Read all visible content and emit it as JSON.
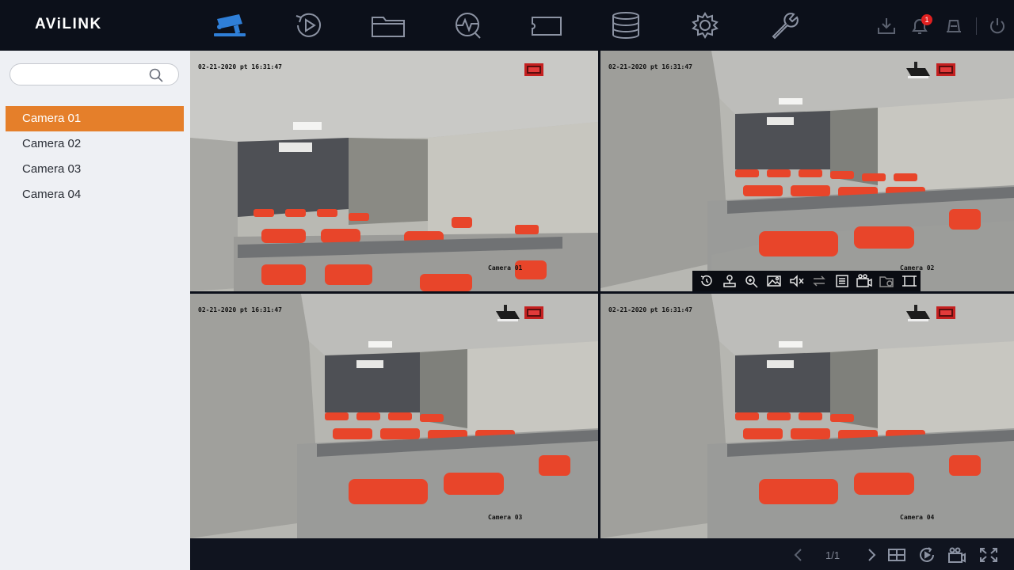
{
  "app": {
    "logo": "AViLINK"
  },
  "topnav": {
    "icons": [
      "live-view-camera-icon",
      "playback-icon",
      "file-folder-icon",
      "smart-analytics-icon",
      "tag-icon",
      "storage-database-icon",
      "settings-gear-icon",
      "maintenance-wrench-icon"
    ],
    "active_color": "#2f7fd8",
    "inactive_color": "#8c93a3"
  },
  "status": {
    "alarm_count": "1",
    "alarm_color": "#e02020"
  },
  "sidebar": {
    "search_placeholder": "",
    "cameras": [
      {
        "label": "Camera 01",
        "active": true
      },
      {
        "label": "Camera 02",
        "active": false
      },
      {
        "label": "Camera 03",
        "active": false
      },
      {
        "label": "Camera 04",
        "active": false
      }
    ],
    "active_color": "#e57f2a"
  },
  "tiles": [
    {
      "timestamp": "02-21-2020 pt 16:31:47",
      "name": "Camera 01"
    },
    {
      "timestamp": "02-21-2020 pt 16:31:47",
      "name": "Camera 02"
    },
    {
      "timestamp": "02-21-2020 pt 16:31:47",
      "name": "Camera 03"
    },
    {
      "timestamp": "02-21-2020 pt 16:31:47",
      "name": "Camera 04"
    }
  ],
  "camera_toolbar": {
    "icons": [
      "instant-playback-icon",
      "ptz-control-icon",
      "digital-zoom-icon",
      "image-settings-icon",
      "audio-icon",
      "switch-stream-icon",
      "info-icon",
      "manual-record-icon",
      "snapshot-icon",
      "fullscreen-icon"
    ]
  },
  "bottombar": {
    "page_indicator": "1/1",
    "icons": [
      "prev-page-icon",
      "next-page-icon",
      "layout-grid-icon",
      "sequence-refresh-icon",
      "record-all-icon",
      "fullscreen-expand-icon"
    ]
  }
}
